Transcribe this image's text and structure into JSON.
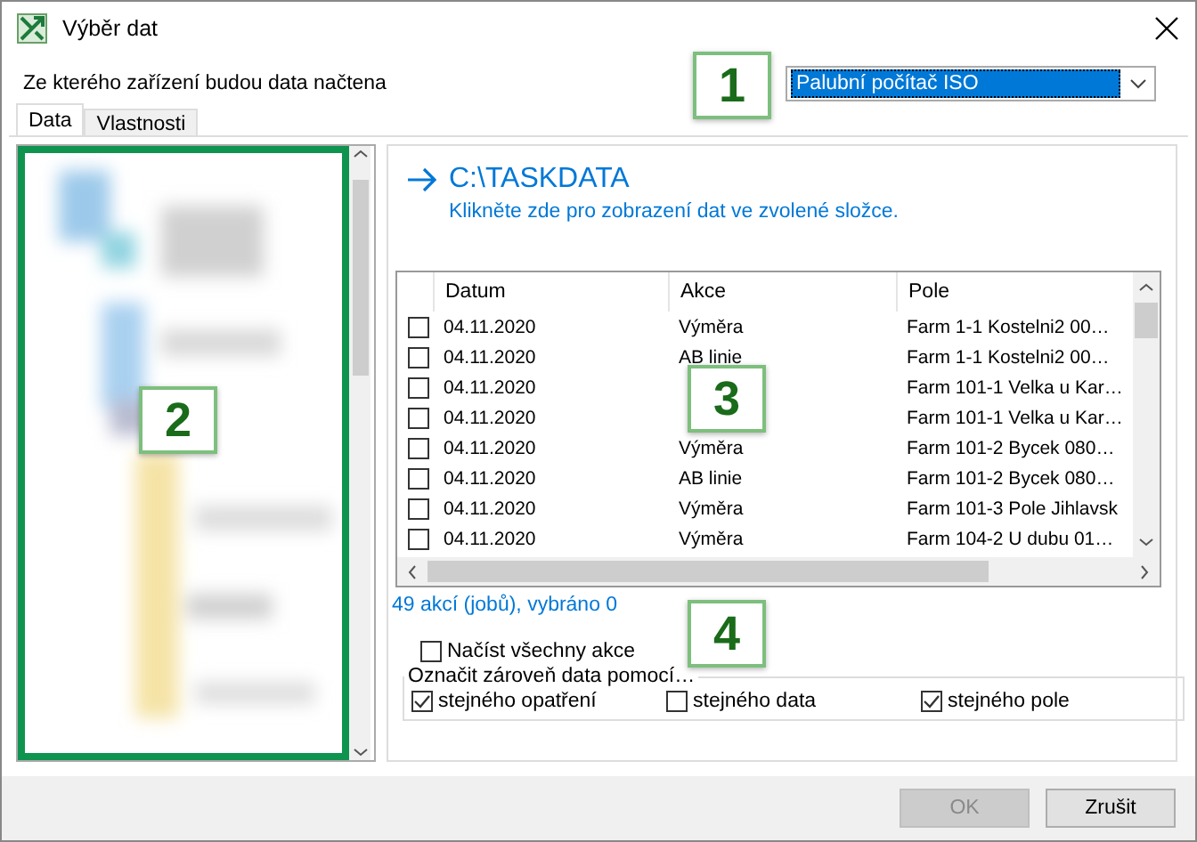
{
  "window": {
    "title": "Výběr dat"
  },
  "device": {
    "label": "Ze kterého zařízení budou data načtena",
    "value": "Palubní počítač ISO"
  },
  "tabs": [
    {
      "label": "Data",
      "selected": true
    },
    {
      "label": "Vlastnosti",
      "selected": false
    }
  ],
  "folder": {
    "path": "C:\\TASKDATA",
    "hint": "Klikněte zde pro zobrazení dat ve zvolené složce."
  },
  "table": {
    "columns": [
      "Datum",
      "Akce",
      "Pole"
    ],
    "rows": [
      {
        "checked": false,
        "datum": "04.11.2020",
        "akce": "Výměra",
        "pole": "Farm 1-1 Kostelni2  00…"
      },
      {
        "checked": false,
        "datum": "04.11.2020",
        "akce": "AB linie",
        "pole": "Farm 1-1 Kostelni2  00…"
      },
      {
        "checked": false,
        "datum": "04.11.2020",
        "pole": "Farm 101-1 Velka u Kar…"
      },
      {
        "checked": false,
        "datum": "04.11.2020",
        "pole": "Farm 101-1 Velka u Kar…"
      },
      {
        "checked": false,
        "datum": "04.11.2020",
        "akce": "Výměra",
        "pole": "Farm 101-2 Bycek 080…"
      },
      {
        "checked": false,
        "datum": "04.11.2020",
        "akce": "AB linie",
        "pole": "Farm 101-2 Bycek 080…"
      },
      {
        "checked": false,
        "datum": "04.11.2020",
        "akce": "Výměra",
        "pole": "Farm 101-3 Pole Jihlavsk"
      },
      {
        "checked": false,
        "datum": "04.11.2020",
        "akce": "Výměra",
        "pole": "Farm 104-2 U dubu 01…"
      }
    ]
  },
  "summary": "49 akcí (jobů), vybráno 0",
  "load_all": {
    "label": "Načíst všechny akce",
    "checked": false
  },
  "mark_group": {
    "title": "Označit zároveň data pomocí…",
    "options": [
      {
        "label": "stejného opatření",
        "checked": true
      },
      {
        "label": "stejného data",
        "checked": false
      },
      {
        "label": "stejného pole",
        "checked": true
      }
    ]
  },
  "buttons": [
    {
      "label": "OK",
      "disabled": true
    },
    {
      "label": "Zrušit",
      "disabled": false
    }
  ],
  "callouts": [
    "1",
    "2",
    "3",
    "4"
  ]
}
